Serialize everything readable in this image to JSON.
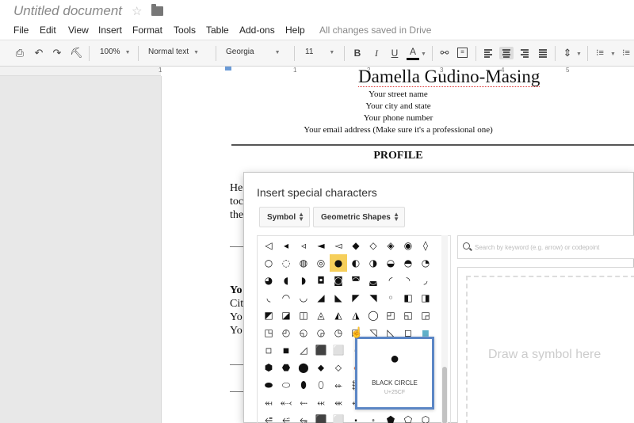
{
  "title": "Untitled document",
  "menu": [
    "File",
    "Edit",
    "View",
    "Insert",
    "Format",
    "Tools",
    "Table",
    "Add-ons",
    "Help"
  ],
  "save_status": "All changes saved in Drive",
  "toolbar": {
    "zoom": "100%",
    "style": "Normal text",
    "font": "Georgia",
    "size": "11"
  },
  "ruler": [
    "1",
    "1",
    "2",
    "3",
    "4",
    "5"
  ],
  "document": {
    "name": "Damella Gudino-Masing",
    "address_lines": [
      "Your street name",
      "Your city and state",
      "Your phone number",
      "Your email address (Make sure it's a professional one)"
    ],
    "profile_heading": "PROFILE",
    "fragment_1": [
      "He",
      "toc",
      "the"
    ],
    "fragment_2": [
      "Yo",
      "Cit",
      "Yo",
      "Yo"
    ]
  },
  "dialog": {
    "title": "Insert special characters",
    "category": "Symbol",
    "subcategory": "Geometric Shapes",
    "search_placeholder": "Search by keyword (e.g. arrow) or codepoint",
    "draw_placeholder": "Draw a symbol here",
    "tooltip": {
      "glyph": "●",
      "name": "BLACK CIRCLE",
      "code": "U+25CF"
    },
    "highlighted_glyph": "●"
  },
  "colors": {
    "highlight": "#f6cf5b",
    "tooltip_border": "#5b86c5"
  }
}
